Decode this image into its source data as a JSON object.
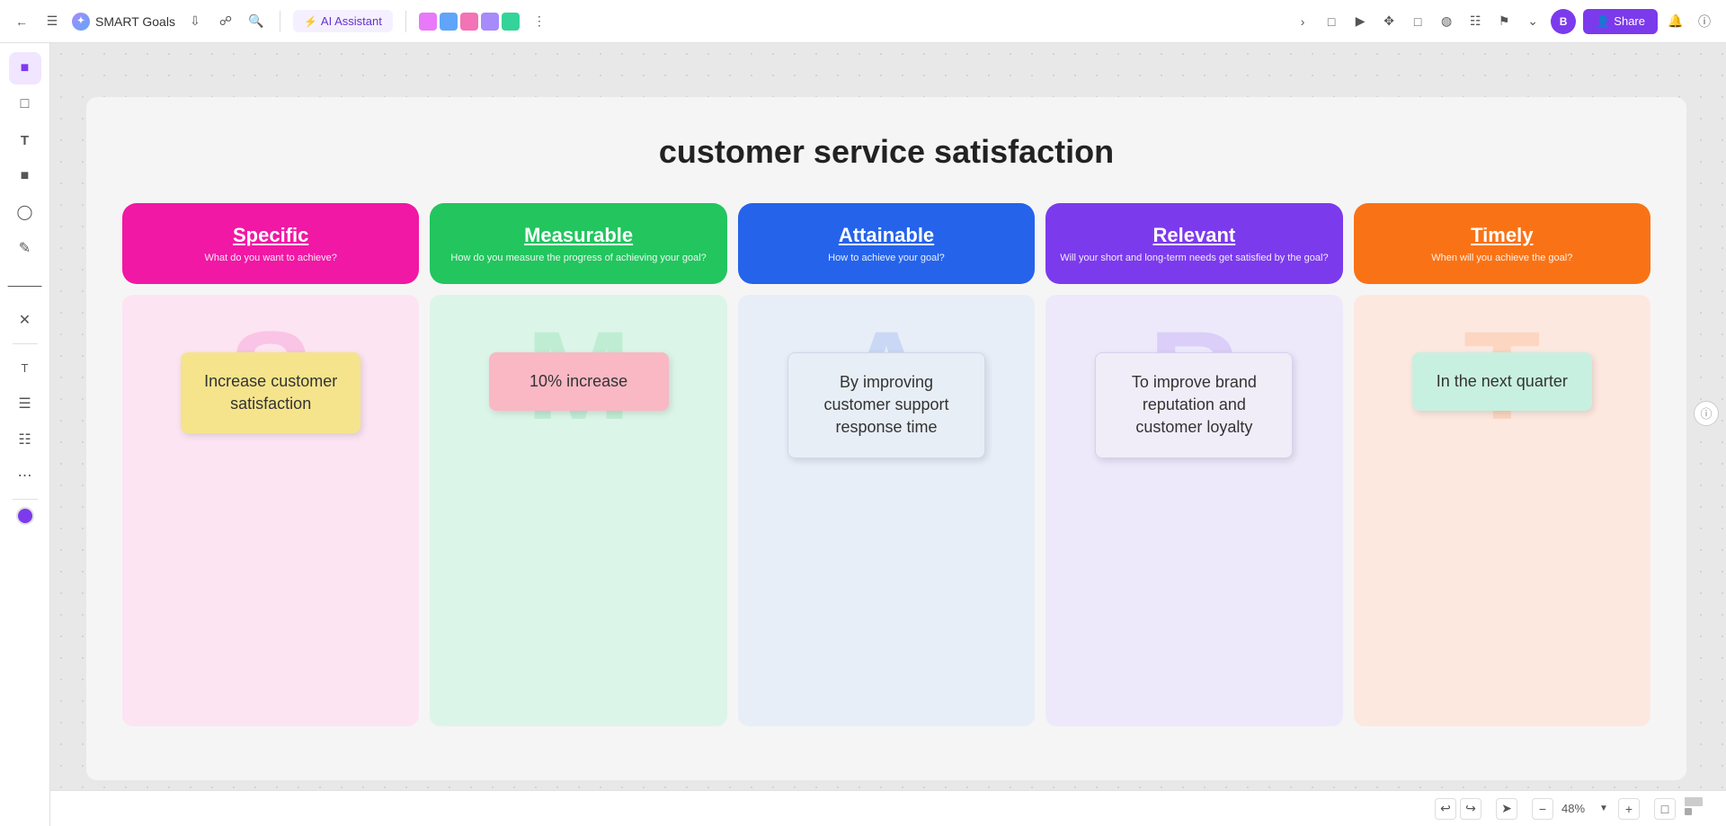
{
  "toolbar": {
    "title": "SMART Goals",
    "ai_label": "AI Assistant",
    "share_label": "Share",
    "zoom_level": "48%"
  },
  "canvas": {
    "main_title": "customer service satisfaction"
  },
  "columns": [
    {
      "id": "specific",
      "header_title": "Specific",
      "header_subtitle": "What do you want to achieve?",
      "bg_letter": "S",
      "note_text": "Increase customer satisfaction",
      "note_class": "note-yellow"
    },
    {
      "id": "measurable",
      "header_title": "Measurable",
      "header_subtitle": "How do you measure the progress of achieving your goal?",
      "bg_letter": "M",
      "note_text": "10% increase",
      "note_class": "note-pink"
    },
    {
      "id": "attainable",
      "header_title": "Attainable",
      "header_subtitle": "How to achieve your goal?",
      "bg_letter": "A",
      "note_text": "By improving customer support response time",
      "note_class": "note-white-blue"
    },
    {
      "id": "relevant",
      "header_title": "Relevant",
      "header_subtitle": "Will your short and long-term needs get satisfied by the goal?",
      "bg_letter": "R",
      "note_text": "To improve brand reputation and customer loyalty",
      "note_class": "note-white-purple"
    },
    {
      "id": "timely",
      "header_title": "Timely",
      "header_subtitle": "When will you achieve the goal?",
      "bg_letter": "T",
      "note_text": "In the next quarter",
      "note_class": "note-mint"
    }
  ],
  "header_colors": {
    "specific": "#f018a4",
    "measurable": "#22c55e",
    "attainable": "#2563eb",
    "relevant": "#7c3aed",
    "timely": "#f97316"
  },
  "body_colors": {
    "specific": "#fce4f3",
    "measurable": "#dcf5e9",
    "attainable": "#e8eef8",
    "relevant": "#ede9fb",
    "timely": "#fde8e0"
  },
  "note_colors": {
    "specific": "#f5e48c",
    "measurable": "#f9b8c4",
    "attainable": "#e8eef5",
    "relevant": "#f0edf8",
    "timely": "#c8f0e0"
  }
}
